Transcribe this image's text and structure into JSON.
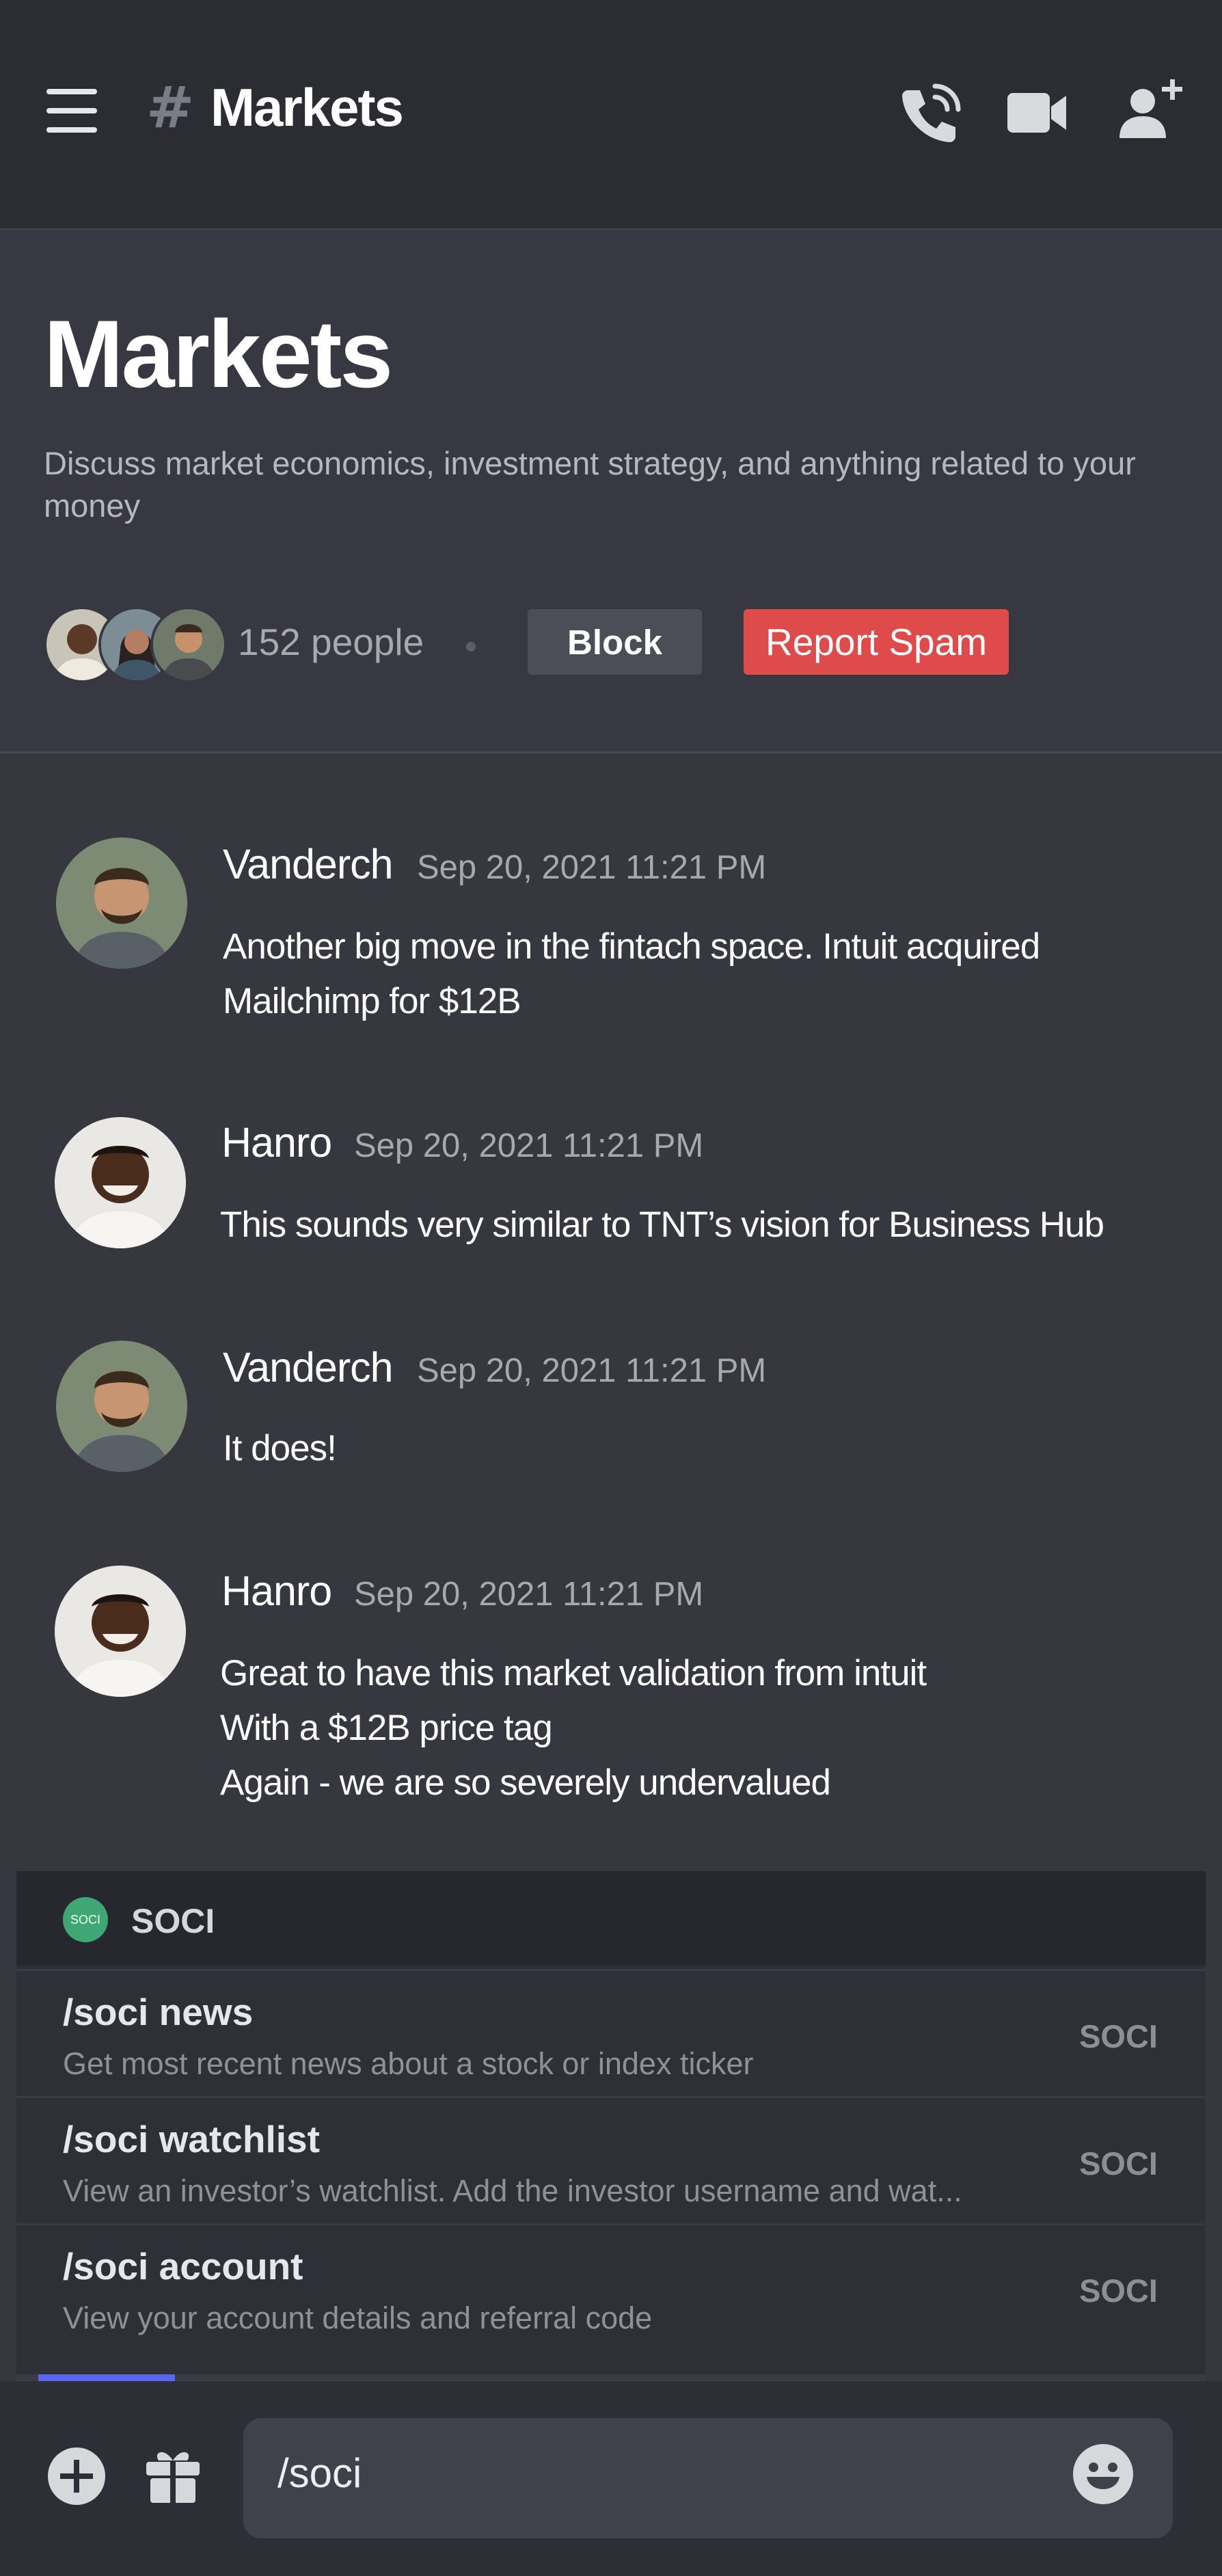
{
  "topbar": {
    "title": "Markets"
  },
  "header": {
    "title": "Markets",
    "description": "Discuss market economics, investment strategy, and anything related to your money",
    "people_count": "152 people",
    "block_label": "Block",
    "report_spam_label": "Report Spam"
  },
  "messages": [
    {
      "author": "Vanderch",
      "time": "Sep 20, 2021 11:21 PM",
      "lines": [
        "Another big move in the fintach space. Intuit acquired",
        "Mailchimp for $12B"
      ]
    },
    {
      "author": "Hanro",
      "time": "Sep 20, 2021 11:21 PM",
      "lines": [
        "This sounds very similar to TNT’s vision for Business Hub"
      ]
    },
    {
      "author": "Vanderch",
      "time": "Sep 20, 2021 11:21 PM",
      "lines": [
        "It does!"
      ]
    },
    {
      "author": "Hanro",
      "time": "Sep 20, 2021 11:21 PM",
      "lines": [
        "Great to have this market validation from intuit",
        "With a $12B price tag",
        "Again - we are so severely undervalued"
      ]
    }
  ],
  "commands": {
    "header_label": "SOCI",
    "logo_text": "SOCI",
    "items": [
      {
        "name": "/soci news",
        "description": "Get most recent news about a stock or index ticker",
        "tag": "SOCI"
      },
      {
        "name": "/soci watchlist",
        "description": "View an investor’s watchlist. Add the investor username and wat...",
        "tag": "SOCI"
      },
      {
        "name": "/soci account",
        "description": "View your account details and referral code",
        "tag": "SOCI"
      }
    ],
    "scroll_fraction": 0.05
  },
  "composer": {
    "value": "/soci"
  },
  "icons": {
    "menu": "hamburger-menu-icon",
    "call": "phone-call-icon",
    "video": "video-camera-icon",
    "add_user": "add-user-icon",
    "add": "plus-circle-icon",
    "gift": "gift-icon",
    "emoji": "emoji-icon"
  },
  "colors": {
    "accent": "#5865f2",
    "danger": "#df4b4b",
    "soci": "#3fa774"
  }
}
